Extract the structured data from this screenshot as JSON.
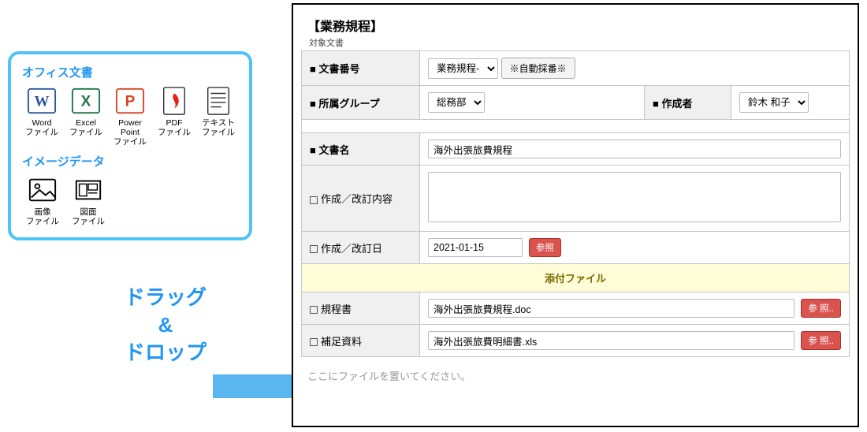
{
  "info_panel": {
    "section1_title": "オフィス文書",
    "section2_title": "イメージデータ",
    "files_office": [
      {
        "name": "word-icon",
        "label": "Word\nファイル"
      },
      {
        "name": "excel-icon",
        "label": "Excel\nファイル"
      },
      {
        "name": "ppt-icon",
        "label": "Power\nPoint\nファイル"
      },
      {
        "name": "pdf-icon",
        "label": "PDF\nファイル"
      },
      {
        "name": "text-icon",
        "label": "テキスト\nファイル"
      }
    ],
    "files_image": [
      {
        "name": "image-icon",
        "label": "画像\nファイル"
      },
      {
        "name": "drawing-icon",
        "label": "図面\nファイル"
      }
    ]
  },
  "drag_drop": {
    "line1": "ドラッグ",
    "line2": "&",
    "line3": "ドロップ"
  },
  "form": {
    "title": "【業務規程】",
    "sublabel": "対象文書",
    "row_doc_no": {
      "label": "■ 文書番号",
      "select_value": "業務規程-",
      "auto_btn": "※自動採番※"
    },
    "row_group": {
      "label": "■ 所属グループ",
      "select_value": "総務部",
      "author_label": "■ 作成者",
      "author_value": "鈴木 和子"
    },
    "row_doc_name": {
      "label": "■ 文書名",
      "value": "海外出張旅費規程"
    },
    "row_revision": {
      "label": "作成／改訂内容",
      "value": ""
    },
    "row_date": {
      "label": "作成／改訂日",
      "value": "2021-01-15",
      "ref_btn": "参照"
    },
    "attach": {
      "header": "添付ファイル",
      "row1_label": "規程書",
      "row1_value": "海外出張旅費規程.doc",
      "row2_label": "補足資料",
      "row2_value": "海外出張旅費明細書.xls",
      "ref_btn": "参 照..",
      "drop_hint": "ここにファイルを置いてください。"
    }
  }
}
